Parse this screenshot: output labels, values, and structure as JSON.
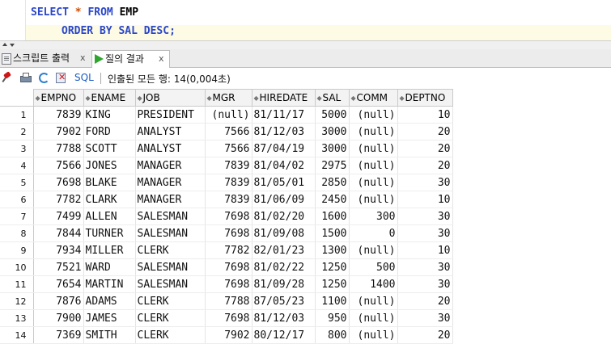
{
  "editor": {
    "line1": {
      "kw1": "SELECT",
      "star": "*",
      "kw2": "FROM",
      "table": "EMP"
    },
    "line2": {
      "kw1": "ORDER BY",
      "col": "SAL",
      "kw2": "DESC;"
    }
  },
  "tabs": [
    {
      "label": "스크립트 출력",
      "close": "x"
    },
    {
      "label": "질의 결과",
      "close": "x"
    }
  ],
  "toolbar": {
    "sql_label": "SQL",
    "fetched_text": "인출된 모든 행: 14(0,004초)"
  },
  "grid": {
    "columns": [
      "EMPNO",
      "ENAME",
      "JOB",
      "MGR",
      "HIREDATE",
      "SAL",
      "COMM",
      "DEPTNO"
    ],
    "rows": [
      [
        "1",
        "7839",
        "KING",
        "PRESIDENT",
        "(null)",
        "81/11/17",
        "5000",
        "(null)",
        "10"
      ],
      [
        "2",
        "7902",
        "FORD",
        "ANALYST",
        "7566",
        "81/12/03",
        "3000",
        "(null)",
        "20"
      ],
      [
        "3",
        "7788",
        "SCOTT",
        "ANALYST",
        "7566",
        "87/04/19",
        "3000",
        "(null)",
        "20"
      ],
      [
        "4",
        "7566",
        "JONES",
        "MANAGER",
        "7839",
        "81/04/02",
        "2975",
        "(null)",
        "20"
      ],
      [
        "5",
        "7698",
        "BLAKE",
        "MANAGER",
        "7839",
        "81/05/01",
        "2850",
        "(null)",
        "30"
      ],
      [
        "6",
        "7782",
        "CLARK",
        "MANAGER",
        "7839",
        "81/06/09",
        "2450",
        "(null)",
        "10"
      ],
      [
        "7",
        "7499",
        "ALLEN",
        "SALESMAN",
        "7698",
        "81/02/20",
        "1600",
        "300",
        "30"
      ],
      [
        "8",
        "7844",
        "TURNER",
        "SALESMAN",
        "7698",
        "81/09/08",
        "1500",
        "0",
        "30"
      ],
      [
        "9",
        "7934",
        "MILLER",
        "CLERK",
        "7782",
        "82/01/23",
        "1300",
        "(null)",
        "10"
      ],
      [
        "10",
        "7521",
        "WARD",
        "SALESMAN",
        "7698",
        "81/02/22",
        "1250",
        "500",
        "30"
      ],
      [
        "11",
        "7654",
        "MARTIN",
        "SALESMAN",
        "7698",
        "81/09/28",
        "1250",
        "1400",
        "30"
      ],
      [
        "12",
        "7876",
        "ADAMS",
        "CLERK",
        "7788",
        "87/05/23",
        "1100",
        "(null)",
        "20"
      ],
      [
        "13",
        "7900",
        "JAMES",
        "CLERK",
        "7698",
        "81/12/03",
        "950",
        "(null)",
        "30"
      ],
      [
        "14",
        "7369",
        "SMITH",
        "CLERK",
        "7902",
        "80/12/17",
        "800",
        "(null)",
        "20"
      ]
    ]
  }
}
